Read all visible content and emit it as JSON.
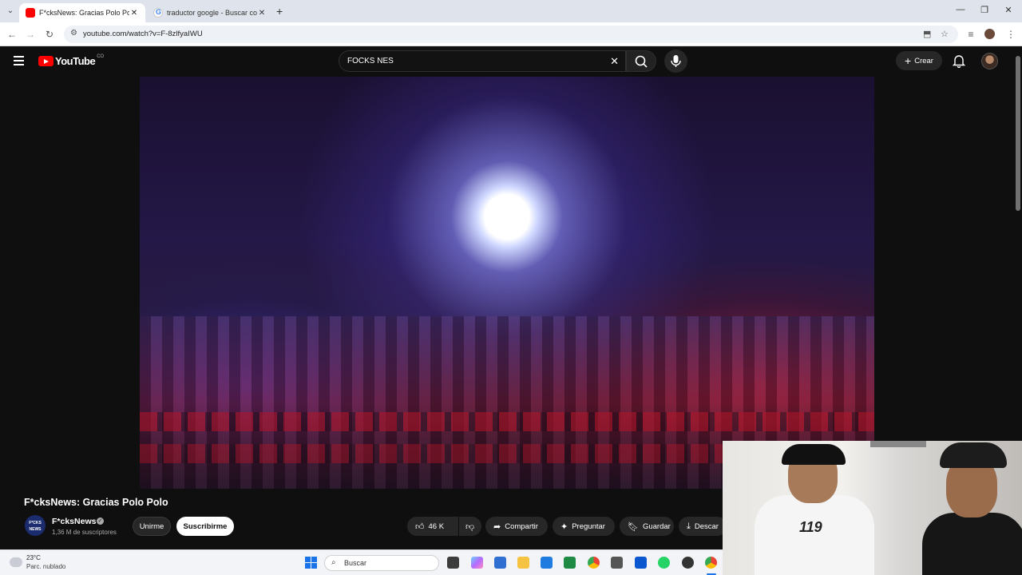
{
  "browser": {
    "tabs": [
      {
        "title": "F*cksNews: Gracias Polo Polo -",
        "active": true
      },
      {
        "title": "traductor google - Buscar con G",
        "active": false
      }
    ],
    "url": "youtube.com/watch?v=F-8zlfyaIWU"
  },
  "youtube": {
    "logo_text": "YouTube",
    "country_code": "CO",
    "search_query": "FOCKS NES",
    "create_label": "Crear"
  },
  "video": {
    "title": "F*cksNews: Gracias Polo Polo",
    "channel": {
      "name": "F*cksNews",
      "avatar_text": "F*CKS NEWS",
      "subscribers": "1,36 M de suscriptores",
      "join_label": "Unirme",
      "subscribe_label": "Suscribirme"
    },
    "actions": {
      "likes": "46 K",
      "share": "Compartir",
      "ask": "Preguntar",
      "save": "Guardar",
      "download": "Descar"
    }
  },
  "webcam": {
    "shirt_logo": "119"
  },
  "taskbar": {
    "temperature": "23°C",
    "condition": "Parc. nublado",
    "search_label": "Buscar"
  }
}
